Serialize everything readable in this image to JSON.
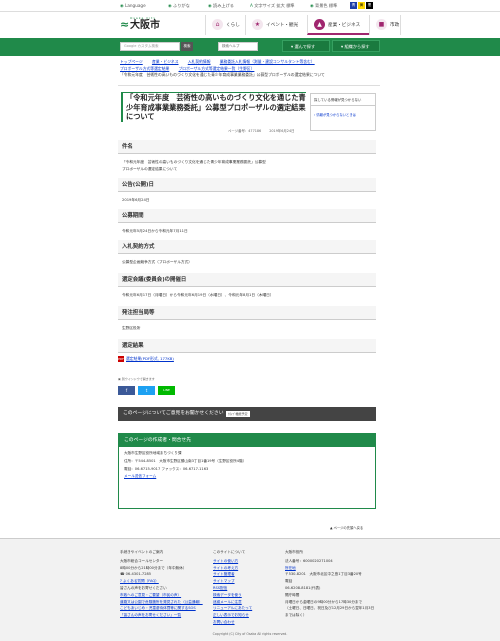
{
  "topbar": {
    "language": "Language",
    "furigana": "ふりがな",
    "read_aloud": "読み上げる",
    "text_size_label": "文字サイズ",
    "text_size_large": "拡大",
    "text_size_standard": "標準",
    "color_label": "背景色",
    "color_standard": "標準",
    "color_a": "青",
    "color_b": "黄",
    "color_c": "黒"
  },
  "header": {
    "logo_sub": "Osaka City",
    "logo_name": "大阪市",
    "categories": [
      {
        "label": "くらし",
        "icon": "home-icon"
      },
      {
        "label": "イベント・観光",
        "icon": "event-icon"
      },
      {
        "label": "産業・ビジネス",
        "icon": "business-icon"
      },
      {
        "label": "市政",
        "icon": "city-icon"
      }
    ]
  },
  "search": {
    "placeholder": "Google カスタム検索",
    "button": "検索",
    "dropdown": "検索ヘルプ",
    "browse_button": "選んで探す",
    "area_button": "組織から探す"
  },
  "breadcrumb": {
    "items": [
      "トップページ",
      "産業・ビジネス",
      "入札契約情報",
      "業務委託入札情報（測量・建設コンサルタント等含む）",
      "プロポーザル方式等選定結果",
      "プロポーザル方式等選定結果一覧（生野区）"
    ],
    "current": "「令和元年度　芸術性の高いものづくり文化を通じた青少年育成事業業務委託」公募型プロポーザルの選定結果について"
  },
  "page": {
    "title": "「令和元年度　芸術性の高いものづくり文化を通じた青少年育成事業業務委託」公募型プロポーザルの選定結果について",
    "page_id": "ページ番号：477186",
    "date": "2019年6月24日"
  },
  "sections": [
    {
      "heading": "件名",
      "body": [
        "「令和元年度　芸術性の高いものづくり文化を通じた青少年育成事業業務委託」公募型",
        "プロポーザルの選定結果について"
      ]
    },
    {
      "heading": "公告(公開)日",
      "body": [
        "2019年6月24日"
      ]
    },
    {
      "heading": "公募期間",
      "body": [
        "令和元年5月24日から令和元年7月11日"
      ]
    },
    {
      "heading": "入札契約方式",
      "body": [
        "公募型企画競争方式（プロポーザル方式）"
      ]
    },
    {
      "heading": "選定会議(委員会)の開催日",
      "body": [
        "令和元年6月17日（月曜日）から令和元年6月19日（水曜日）、令和元年8月1日（木曜日）"
      ]
    },
    {
      "heading": "発注担当局等",
      "body": [
        "生野区役所"
      ]
    },
    {
      "heading": "選定結果",
      "body": []
    }
  ],
  "attachment": {
    "icon": "pdf-icon",
    "label": "選定結果(PDF形式, 177KB)"
  },
  "adobe_note": "別ウインドウで開きます",
  "social": [
    "f",
    "t",
    "LINE"
  ],
  "feedback": {
    "label": "このページについてご意見をお聞かせください",
    "tag": "ｶﾗｲﾌﾞ機能予定"
  },
  "contact": {
    "heading": "このページの作成者・問合せ先",
    "lines": [
      "大阪市生野区役所地域まちづくり課",
      "住所：〒544-8501　大阪市生野区勝山南3丁目1番19号（生野区役所4階）",
      "電話：06-6715-9017 ファックス：06-6717-1163"
    ],
    "link": "メール送信フォーム"
  },
  "to_top": "ページの先頭へ戻る",
  "side": {
    "heading": "探している情報が見つからない",
    "link": "情報が見つからないときは"
  },
  "footer": {
    "col1_title": "手続きやイベントのご案内",
    "col1_lines": [
      "大阪市総合コールセンター",
      "8時00分から21時00分まで（年中無休）",
      "06-4301-7285",
      "よくある質問（FAQ）",
      "皆さんの声をお寄せください",
      "市政へのご意見・ご要望（市民の声）",
      "道路又は公園で危険箇所を発見された（公益通報）",
      "こどもあいじめ・児童虐待体罰等に関するSOS",
      "「皆さんの声をお寄せください」一覧"
    ],
    "col2_title": "このサイトについて",
    "col2_links": [
      "サイトの使い方",
      "サイトの考え方",
      "サイト管理者",
      "サイトマップ",
      "RSS配信",
      "検索データを使う",
      "迷惑メールに注意",
      "リニューアルにあたって",
      "正しい表示でお知らせ",
      "お問い合わせ"
    ],
    "col3_title": "大阪市役所",
    "col3_lines": [
      "法人番号：6000020271004",
      "所在地",
      "〒530-8201　大阪市北区中之島1丁目3番20号",
      "電話",
      "06-6208-8181(代表)",
      "開庁時間",
      "月曜日から金曜日の9時00分から17時30分まで",
      "（土曜日、日曜日、祝日及び12月29日から翌年1月3日までは除く）"
    ]
  },
  "copyright": "Copyright (C) City of Osaka All rights reserved."
}
